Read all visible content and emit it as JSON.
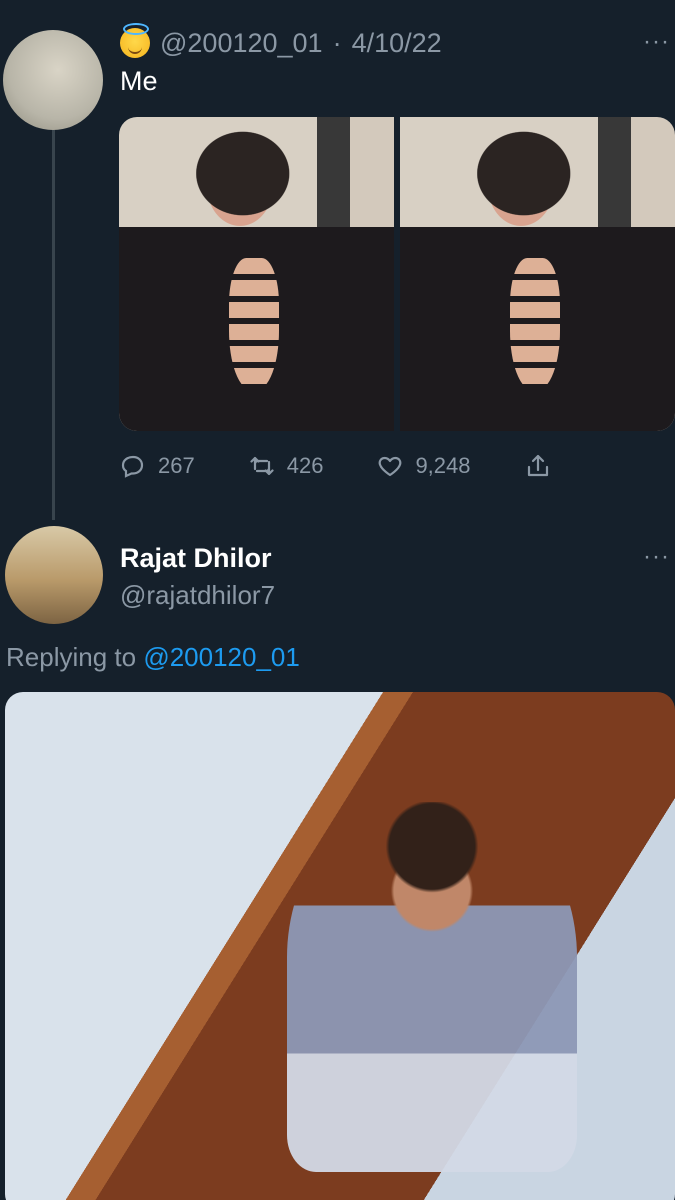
{
  "tweet": {
    "handle": "@200120_01",
    "separator": "·",
    "date": "4/10/22",
    "text": "Me",
    "more_glyph": "···",
    "emoji_name": "smiling-face-with-halo",
    "media_count": 2,
    "counts": {
      "replies": "267",
      "retweets": "426",
      "likes": "9,248"
    }
  },
  "reply": {
    "name": "Rajat Dhilor",
    "handle": "@rajatdhilor7",
    "replying_to_label": "Replying to",
    "replying_to_handle": "@200120_01",
    "more_glyph": "···"
  },
  "colors": {
    "background": "#15202b",
    "secondary_text": "#8b98a5",
    "accent": "#1d9bf0",
    "thread_line": "#38444d"
  },
  "icons": {
    "reply": "reply-icon",
    "retweet": "retweet-icon",
    "like": "heart-icon",
    "share": "share-icon"
  }
}
